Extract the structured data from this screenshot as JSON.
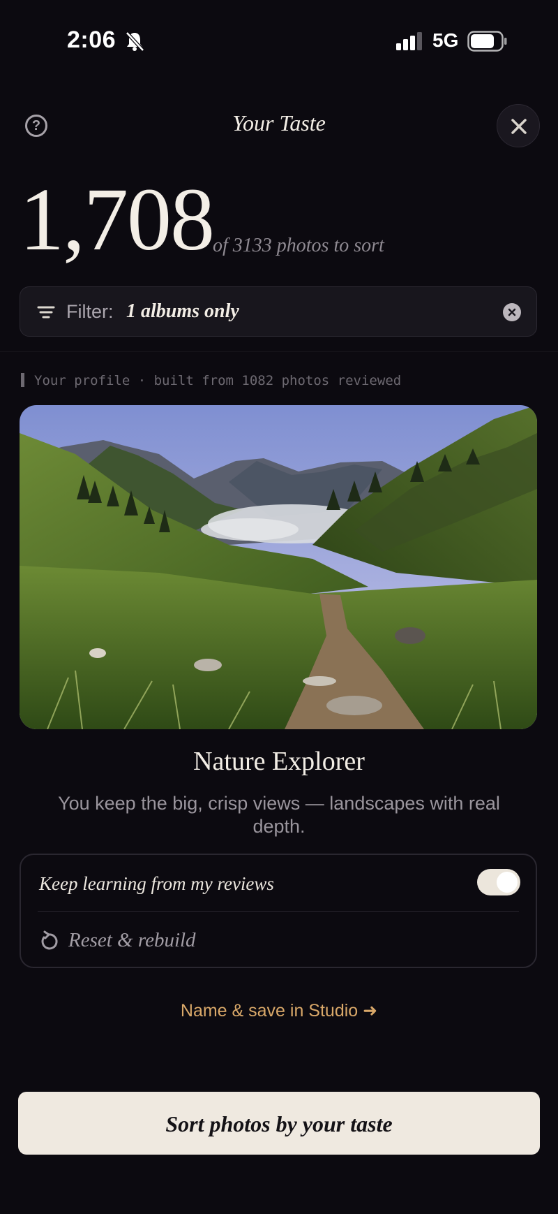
{
  "status_bar": {
    "time": "2:06",
    "network": "5G"
  },
  "header": {
    "title": "Your Taste"
  },
  "summary": {
    "count": "1,708",
    "subtitle": "of 3133  photos to sort"
  },
  "filter": {
    "label": "Filter:",
    "value": "1 albums only"
  },
  "profile": {
    "caption": "Your profile · built from 1082 photos reviewed",
    "name": "Nature Explorer",
    "description": "You keep the big, crisp views — landscapes with real depth."
  },
  "settings": {
    "learn_label": "Keep learning from my reviews",
    "learn_enabled": true,
    "reset_label": "Reset & rebuild"
  },
  "studio_link": "Name & save in Studio ➜",
  "primary_button": "Sort photos by your taste",
  "colors": {
    "background": "#0c0a10",
    "accent": "#d9a869",
    "button": "#efe9e0"
  },
  "icons": [
    "bell-muted-icon",
    "signal-icon",
    "battery-icon",
    "help-icon",
    "close-icon",
    "filter-lines-icon",
    "clear-icon",
    "reset-icon"
  ]
}
